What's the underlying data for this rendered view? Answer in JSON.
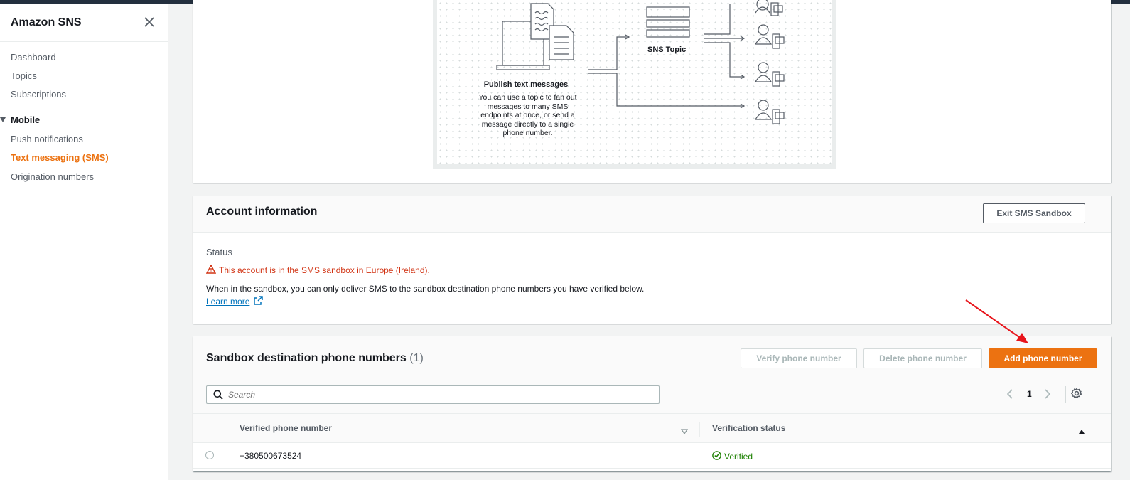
{
  "sidebar": {
    "title": "Amazon SNS",
    "items": [
      {
        "label": "Dashboard"
      },
      {
        "label": "Topics"
      },
      {
        "label": "Subscriptions"
      }
    ],
    "section": "Mobile",
    "mobile_items": [
      {
        "label": "Push notifications"
      },
      {
        "label": "Text messaging (SMS)"
      },
      {
        "label": "Origination numbers"
      }
    ]
  },
  "diagram": {
    "publish_title": "Publish text messages",
    "publish_desc": "You can use a topic to fan out messages to many SMS endpoints at once, or send a message directly to a single phone number.",
    "topic_label": "SNS Topic"
  },
  "account": {
    "title": "Account information",
    "exit_button": "Exit SMS Sandbox",
    "status_label": "Status",
    "status_warning": "This account is in the SMS sandbox in Europe (Ireland).",
    "desc": "When in the sandbox, you can only deliver SMS to the sandbox destination phone numbers you have verified below.",
    "learn_more": "Learn more"
  },
  "sandbox": {
    "title": "Sandbox destination phone numbers",
    "count": "(1)",
    "verify_button": "Verify phone number",
    "delete_button": "Delete phone number",
    "add_button": "Add phone number",
    "search_placeholder": "Search",
    "page": "1",
    "columns": [
      "Verified phone number",
      "Verification status"
    ],
    "rows": [
      {
        "phone": "+380500673524",
        "status": "Verified"
      }
    ]
  },
  "colors": {
    "accent": "#ec7211",
    "link": "#0073bb",
    "error": "#d13212",
    "success": "#1d8102",
    "annotation_arrow": "#e8141b"
  }
}
